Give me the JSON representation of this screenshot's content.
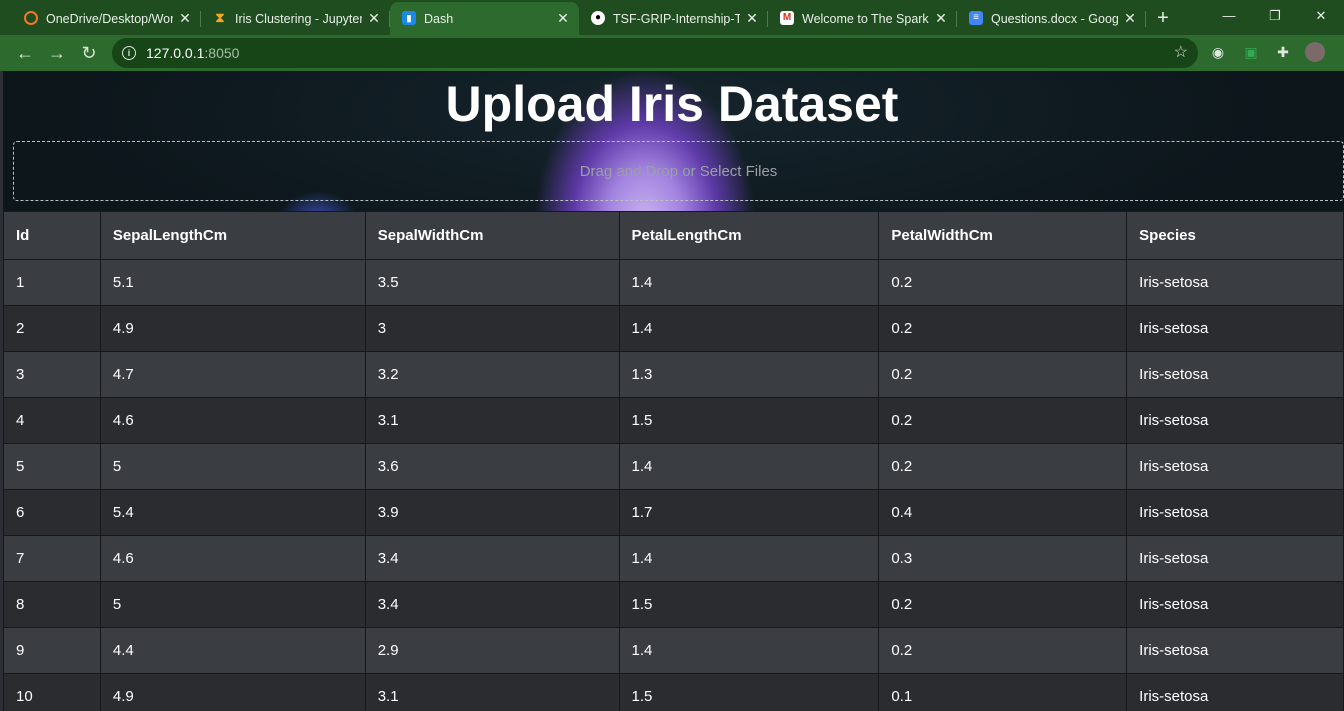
{
  "browser": {
    "tabs": [
      {
        "title": "OneDrive/Desktop/Wor",
        "icon": "jupyter-icon"
      },
      {
        "title": "Iris Clustering - Jupyter",
        "icon": "hourglass-icon"
      },
      {
        "title": "Dash",
        "icon": "dash-icon",
        "active": true
      },
      {
        "title": "TSF-GRIP-Internship-Ta",
        "icon": "github-icon"
      },
      {
        "title": "Welcome to The Sparks",
        "icon": "gmail-icon"
      },
      {
        "title": "Questions.docx - Googl",
        "icon": "docs-icon"
      }
    ],
    "address": {
      "host": "127.0.0.1",
      "port": ":8050"
    }
  },
  "page": {
    "title": "Upload Iris Dataset",
    "upload_label": "Drag and Drop or Select Files"
  },
  "table": {
    "columns": [
      "Id",
      "SepalLengthCm",
      "SepalWidthCm",
      "PetalLengthCm",
      "PetalWidthCm",
      "Species"
    ],
    "rows": [
      [
        "1",
        "5.1",
        "3.5",
        "1.4",
        "0.2",
        "Iris-setosa"
      ],
      [
        "2",
        "4.9",
        "3",
        "1.4",
        "0.2",
        "Iris-setosa"
      ],
      [
        "3",
        "4.7",
        "3.2",
        "1.3",
        "0.2",
        "Iris-setosa"
      ],
      [
        "4",
        "4.6",
        "3.1",
        "1.5",
        "0.2",
        "Iris-setosa"
      ],
      [
        "5",
        "5",
        "3.6",
        "1.4",
        "0.2",
        "Iris-setosa"
      ],
      [
        "6",
        "5.4",
        "3.9",
        "1.7",
        "0.4",
        "Iris-setosa"
      ],
      [
        "7",
        "4.6",
        "3.4",
        "1.4",
        "0.3",
        "Iris-setosa"
      ],
      [
        "8",
        "5",
        "3.4",
        "1.5",
        "0.2",
        "Iris-setosa"
      ],
      [
        "9",
        "4.4",
        "2.9",
        "1.4",
        "0.2",
        "Iris-setosa"
      ],
      [
        "10",
        "4.9",
        "3.1",
        "1.5",
        "0.1",
        "Iris-setosa"
      ]
    ]
  },
  "colors": {
    "browser_frame": "#1f4d1f",
    "toolbar": "#2d6a2d",
    "row_odd": "#3a3d42",
    "row_even": "#2a2c30"
  }
}
